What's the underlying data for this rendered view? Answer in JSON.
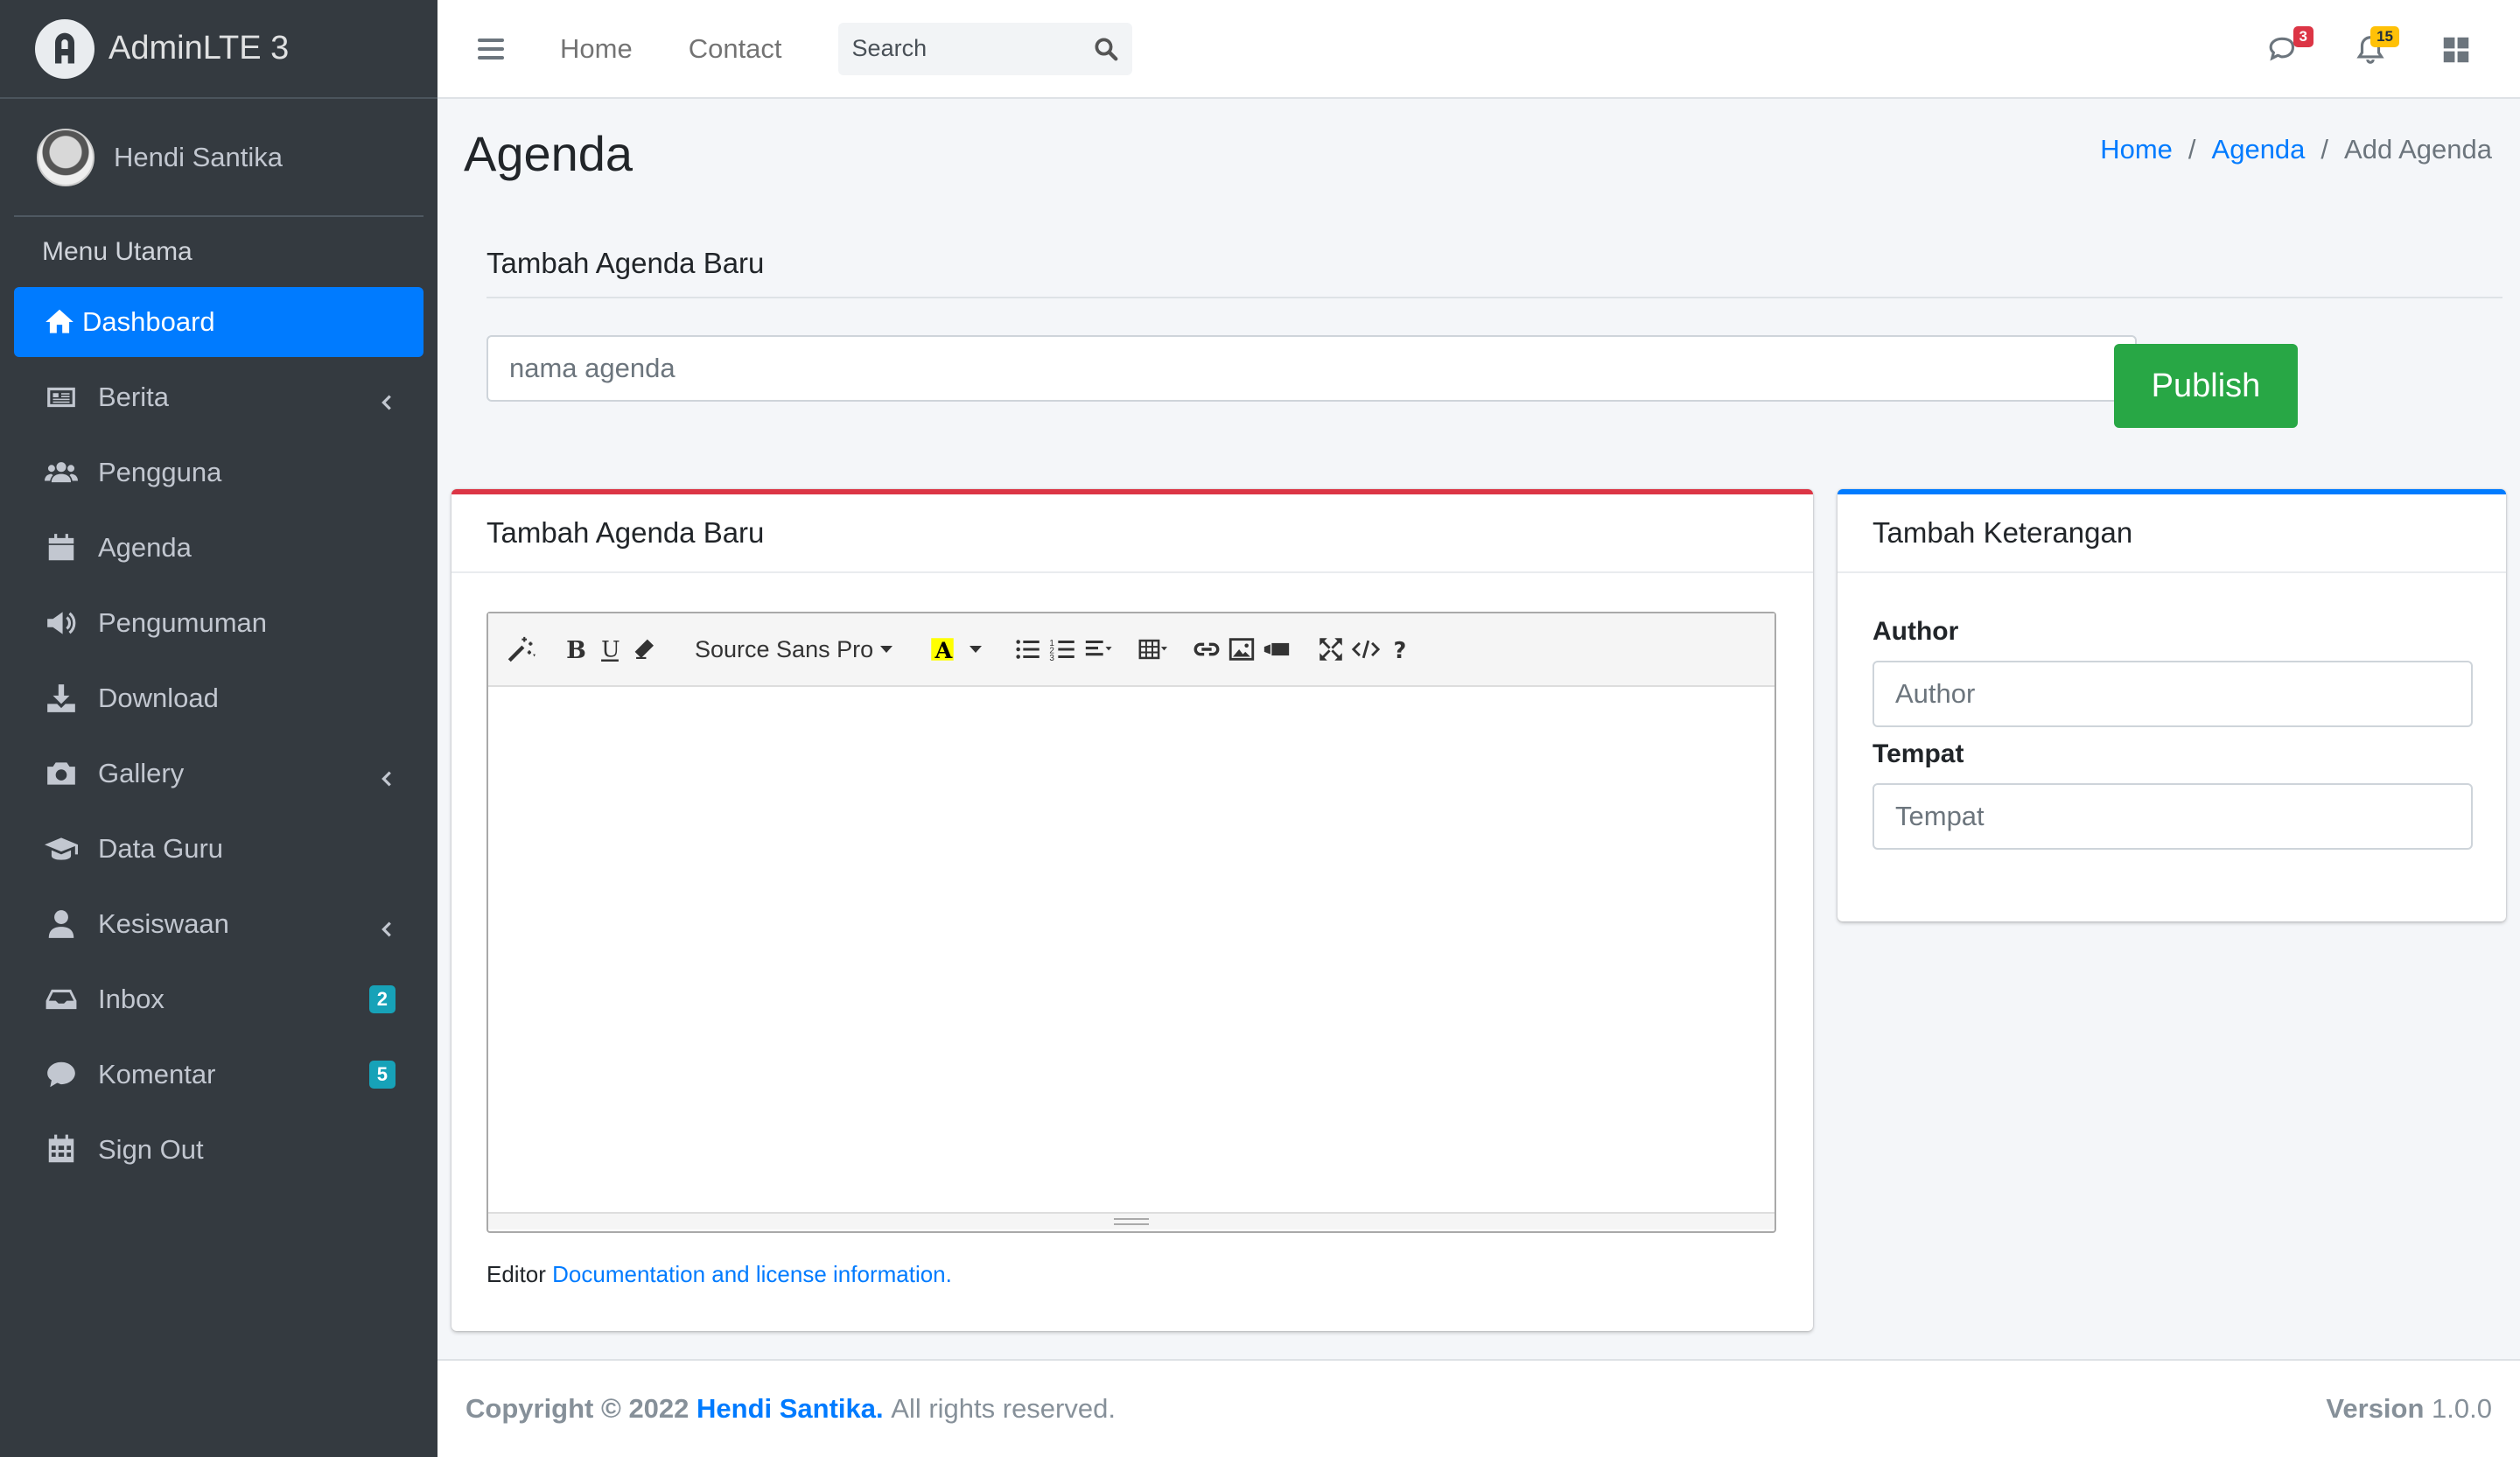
{
  "brand": {
    "name": "AdminLTE 3"
  },
  "user": {
    "name": "Hendi Santika"
  },
  "sidebar": {
    "header": "Menu Utama",
    "items": [
      {
        "label": "Dashboard",
        "icon": "home-icon",
        "active": true
      },
      {
        "label": "Berita",
        "icon": "newspaper-icon",
        "has_children": true
      },
      {
        "label": "Pengguna",
        "icon": "users-icon"
      },
      {
        "label": "Agenda",
        "icon": "calendar-icon"
      },
      {
        "label": "Pengumuman",
        "icon": "megaphone-icon"
      },
      {
        "label": "Download",
        "icon": "download-icon"
      },
      {
        "label": "Gallery",
        "icon": "camera-icon",
        "has_children": true
      },
      {
        "label": "Data Guru",
        "icon": "graduation-cap-icon"
      },
      {
        "label": "Kesiswaan",
        "icon": "user-icon",
        "has_children": true
      },
      {
        "label": "Inbox",
        "icon": "inbox-icon",
        "badge": "2"
      },
      {
        "label": "Komentar",
        "icon": "comment-icon",
        "badge": "5"
      },
      {
        "label": "Sign Out",
        "icon": "calendar-grid-icon"
      }
    ]
  },
  "topbar": {
    "links": [
      "Home",
      "Contact"
    ],
    "search_placeholder": "Search",
    "messages_count": "3",
    "notifications_count": "15"
  },
  "page": {
    "title": "Agenda",
    "breadcrumb": [
      "Home",
      "Agenda",
      "Add Agenda"
    ]
  },
  "form": {
    "section_title": "Tambah Agenda Baru",
    "name_placeholder": "nama agenda",
    "publish_label": "Publish"
  },
  "editor_card": {
    "title": "Tambah Agenda Baru",
    "font_name": "Source Sans Pro",
    "note_prefix": "Editor",
    "note_link": "Documentation and license information."
  },
  "info_card": {
    "title": "Tambah Keterangan",
    "author_label": "Author",
    "author_placeholder": "Author",
    "place_label": "Tempat",
    "place_placeholder": "Tempat"
  },
  "footer": {
    "copyright": "Copyright © 2022",
    "owner": "Hendi Santika.",
    "rights": "All rights reserved.",
    "version_label": "Version",
    "version": "1.0.0"
  },
  "colors": {
    "sidebar_bg": "#343a40",
    "primary": "#007bff",
    "success": "#28a745",
    "danger": "#dc3545",
    "warning": "#ffc107",
    "info": "#17a2b8"
  }
}
